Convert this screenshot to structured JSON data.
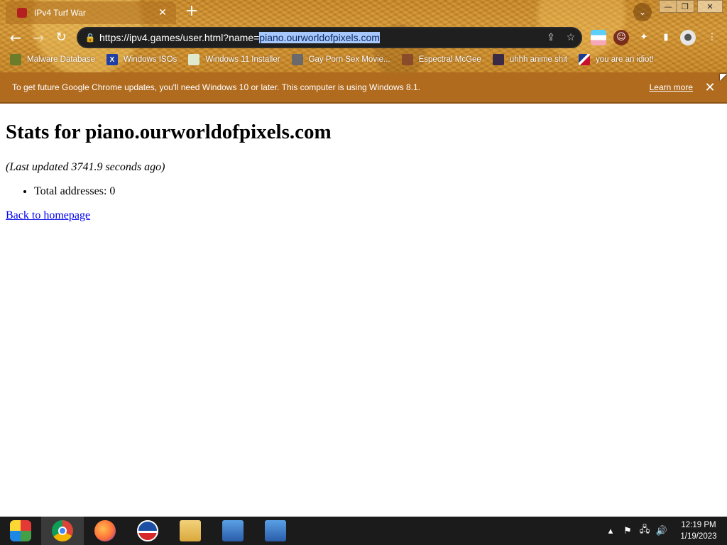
{
  "browser": {
    "tab": {
      "title": "IPv4 Turf War"
    },
    "url": {
      "prefix": "https://ipv4.games/user.html?name=",
      "selected": "piano.ourworldofpixels.com"
    },
    "bookmarks": [
      {
        "label": "Malware Database",
        "icon": "folder-icon"
      },
      {
        "label": "Windows ISOs",
        "icon": "x-icon"
      },
      {
        "label": "Windows 11 Installer",
        "icon": "image-icon"
      },
      {
        "label": "Gay Porn Sex Movie...",
        "icon": "globe-icon"
      },
      {
        "label": "Espectral McGee",
        "icon": "face-icon"
      },
      {
        "label": "uhhh anime shit",
        "icon": "anime-icon"
      },
      {
        "label": "you are an idiot!",
        "icon": "flag-icon"
      }
    ],
    "infobar": {
      "message": "To get future Google Chrome updates, you'll need Windows 10 or later. This computer is using Windows 8.1.",
      "link": "Learn more"
    }
  },
  "page": {
    "title": "Stats for piano.ourworldofpixels.com",
    "updated": "(Last updated 3741.9 seconds ago)",
    "stats": [
      "Total addresses: 0"
    ],
    "back_link": "Back to homepage"
  },
  "taskbar": {
    "time": "12:19 PM",
    "date": "1/19/2023"
  }
}
